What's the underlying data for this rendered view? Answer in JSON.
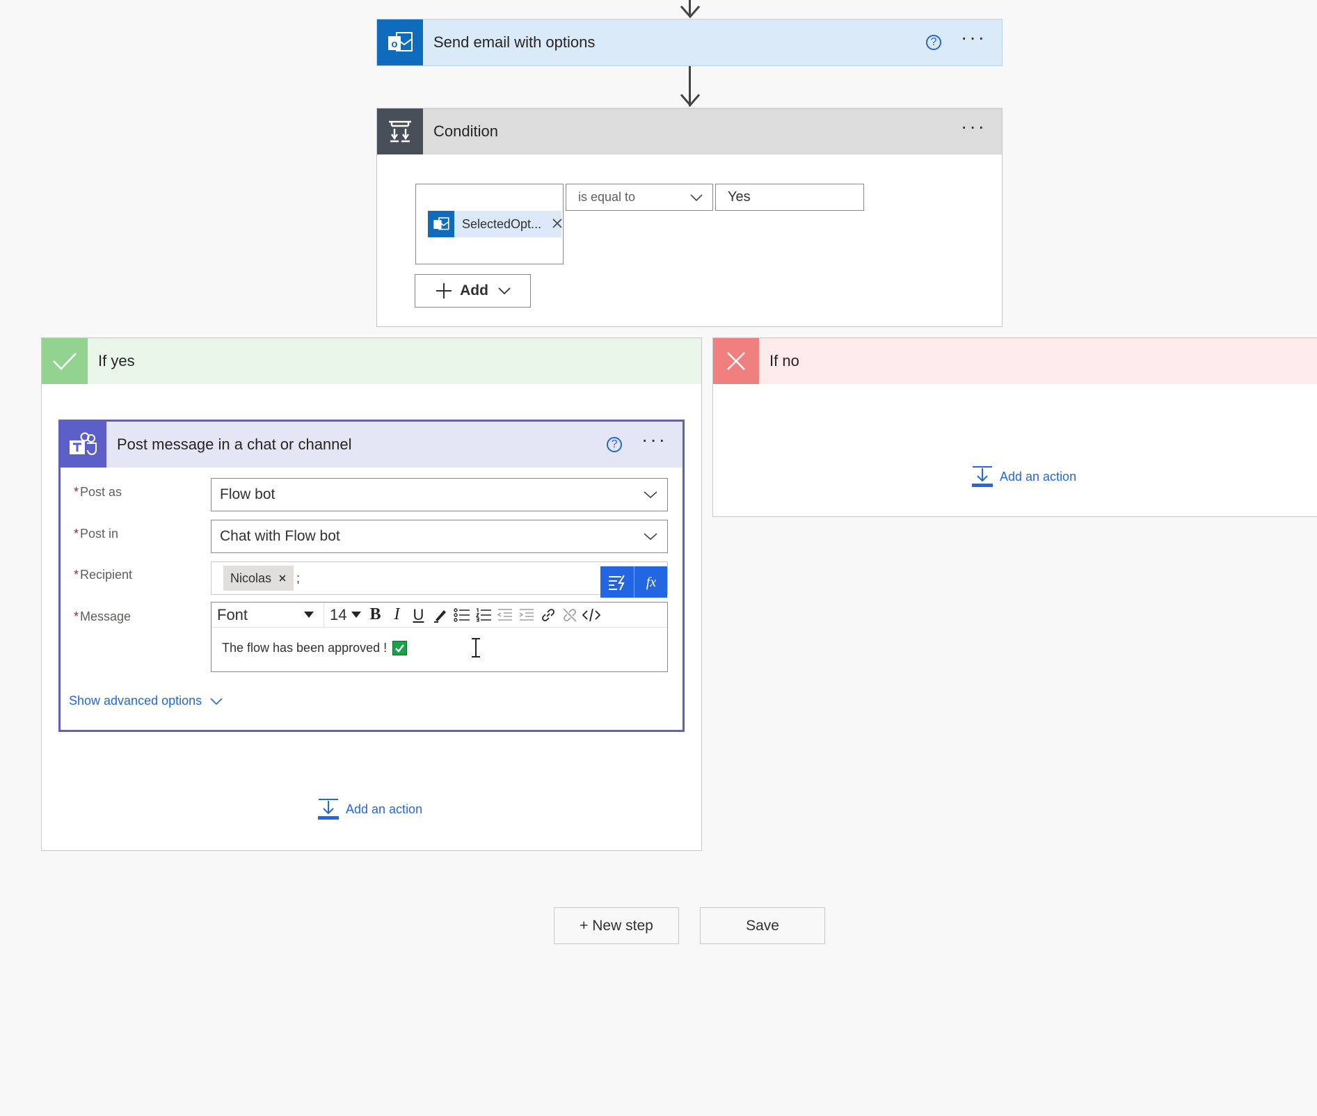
{
  "send_email": {
    "title": "Send email with options",
    "help": "?",
    "more": "···"
  },
  "condition": {
    "title": "Condition",
    "more": "···",
    "token_label": "SelectedOpt...",
    "operator": "is equal to",
    "value": "Yes",
    "add_label": "Add"
  },
  "if_yes": {
    "title": "If yes",
    "add_action": "Add an action"
  },
  "if_no": {
    "title": "If no",
    "add_action": "Add an action"
  },
  "teams_action": {
    "title": "Post message in a chat or channel",
    "help": "?",
    "more": "···",
    "post_as_label": "Post as",
    "post_as_value": "Flow bot",
    "post_in_label": "Post in",
    "post_in_value": "Chat with Flow bot",
    "recipient_label": "Recipient",
    "recipient_chip": "Nicolas",
    "recipient_sep": ";",
    "message_label": "Message",
    "font_select": "Font",
    "font_size": "14",
    "message_text": "The flow has been approved !",
    "show_advanced": "Show advanced options",
    "required_mark": "*"
  },
  "footer": {
    "new_step": "+ New step",
    "save": "Save"
  },
  "colors": {
    "outlook_blue": "#0f6cbd",
    "condition_dark": "#484f58",
    "yes_green": "#92d48f",
    "no_red": "#f08080",
    "teams_purple": "#5b5fc7",
    "link_blue": "#2266e3"
  }
}
